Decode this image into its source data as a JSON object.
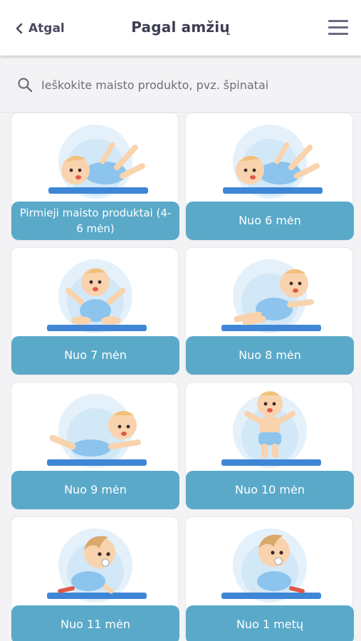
{
  "header": {
    "back_label": "Atgal",
    "title": "Pagal amžių"
  },
  "search": {
    "placeholder": "Ieškokite maisto produkto, pvz. špinatai"
  },
  "colors": {
    "accent": "#5aa9c9",
    "halo": "#d9ecf8",
    "mat": "#3f86d6"
  },
  "age_groups": [
    {
      "label": "Pirmieji maisto produktai (4-6 mėn)",
      "illustration": "baby-lying-icon"
    },
    {
      "label": "Nuo 6 mėn",
      "illustration": "baby-lying-icon"
    },
    {
      "label": "Nuo 7 mėn",
      "illustration": "baby-sitting-icon"
    },
    {
      "label": "Nuo 8 mėn",
      "illustration": "baby-reclining-icon"
    },
    {
      "label": "Nuo 9 mėn",
      "illustration": "baby-tummy-icon"
    },
    {
      "label": "Nuo 10 mėn",
      "illustration": "baby-standing-icon"
    },
    {
      "label": "Nuo 11 mėn",
      "illustration": "baby-crawling-pacifier-icon"
    },
    {
      "label": "Nuo 1 metų",
      "illustration": "baby-crawling-pacifier-icon"
    }
  ]
}
